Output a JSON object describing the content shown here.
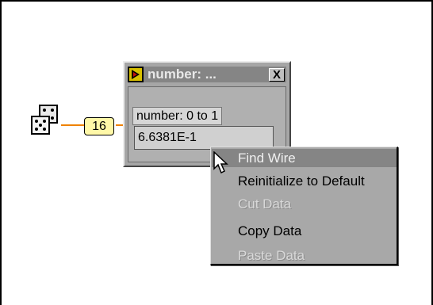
{
  "diagram": {
    "constant_value": "16"
  },
  "probe": {
    "title": "number: ...",
    "close_glyph": "X",
    "label": "number: 0 to 1",
    "value": "6.6381E-1"
  },
  "context_menu": {
    "items": [
      {
        "label": "Find Wire",
        "state": "highlighted"
      },
      {
        "label": "Reinitialize to Default",
        "state": "enabled"
      },
      {
        "label": "Cut Data",
        "state": "disabled"
      },
      {
        "label": "Copy Data",
        "state": "enabled"
      },
      {
        "label": "Paste Data",
        "state": "disabled"
      }
    ]
  },
  "icons": [
    "dice-icon",
    "probe-icon",
    "close-icon",
    "mouse-pointer-icon"
  ],
  "colors": {
    "wire": "#ef8200",
    "constant_bg": "#fff8a8",
    "highlight": "#858585",
    "menu_bg": "#a8a8a8"
  }
}
